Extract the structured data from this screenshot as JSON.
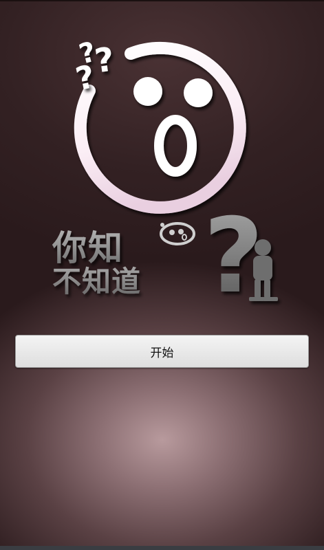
{
  "logo": {
    "title_line1": "你知",
    "title_line2": "不知道",
    "question_marks": "???",
    "big_question": "?",
    "icons": [
      "surprised-face-icon",
      "question-mark-icon",
      "thinking-figure-icon",
      "small-face-icon"
    ]
  },
  "start_button": {
    "label": "开始"
  },
  "colors": {
    "background_dark": "#2d1c1e",
    "background_glow": "#b89a9d",
    "button_face": "#e8e8e8",
    "logo_white": "#ffffff",
    "text_gray": "#8a8a8a"
  }
}
